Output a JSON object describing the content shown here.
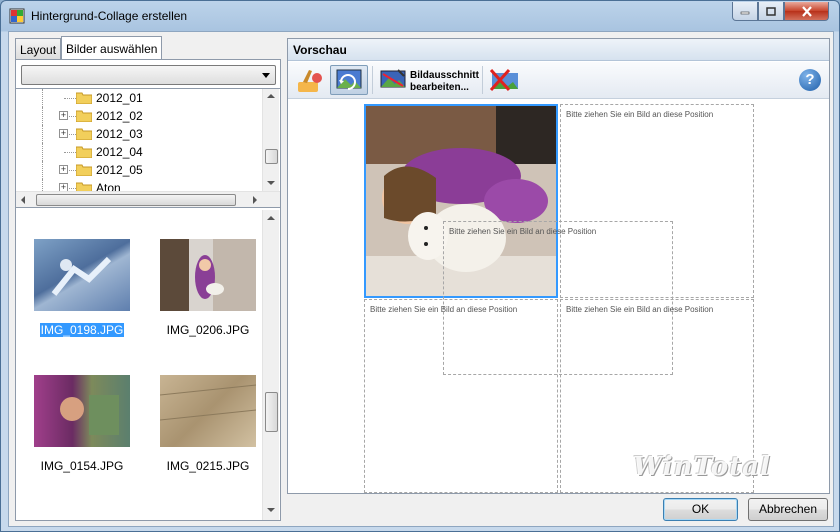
{
  "window": {
    "title": "Hintergrund-Collage erstellen"
  },
  "tabs": [
    {
      "label": "Layout"
    },
    {
      "label": "Bilder auswählen"
    }
  ],
  "folder_select": {
    "value": ""
  },
  "tree": {
    "items": [
      {
        "label": "2012_01",
        "expandable": false
      },
      {
        "label": "2012_02",
        "expandable": true
      },
      {
        "label": "2012_03",
        "expandable": true
      },
      {
        "label": "2012_04",
        "expandable": false
      },
      {
        "label": "2012_05",
        "expandable": true
      },
      {
        "label": "Aton",
        "expandable": true
      }
    ]
  },
  "thumbnails": [
    {
      "name": "IMG_0198.JPG",
      "selected": true
    },
    {
      "name": "IMG_0206.JPG",
      "selected": false
    },
    {
      "name": "IMG_0154.JPG",
      "selected": false
    },
    {
      "name": "IMG_0215.JPG",
      "selected": false
    }
  ],
  "preview": {
    "header": "Vorschau",
    "edit_button_label_line1": "Bildausschnitt",
    "edit_button_label_line2": "bearbeiten...",
    "help_label": "?",
    "slot_placeholder": "Bitte ziehen Sie ein Bild an diese Position",
    "watermark": "WinTotal"
  },
  "buttons": {
    "ok": "OK",
    "cancel": "Abbrechen"
  }
}
